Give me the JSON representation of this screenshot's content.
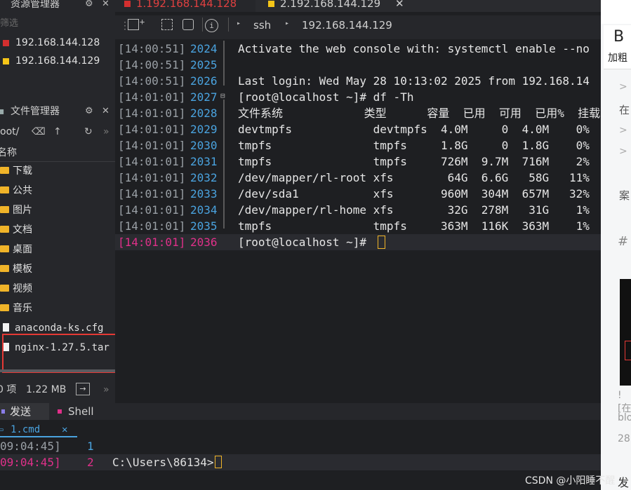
{
  "resource_manager": {
    "title": "资源管理器",
    "filter_placeholder": "筛选",
    "sessions": [
      {
        "label": "192.168.144.128",
        "color": "#d32f2f"
      },
      {
        "label": "192.168.144.129",
        "color": "#f5c518"
      }
    ]
  },
  "file_manager": {
    "title": "文件管理器",
    "path": "oot/",
    "column_name": "名称",
    "items": [
      {
        "name": "下载",
        "type": "folder"
      },
      {
        "name": "公共",
        "type": "folder"
      },
      {
        "name": "图片",
        "type": "folder"
      },
      {
        "name": "文档",
        "type": "folder"
      },
      {
        "name": "桌面",
        "type": "folder"
      },
      {
        "name": "模板",
        "type": "folder"
      },
      {
        "name": "视频",
        "type": "folder"
      },
      {
        "name": "音乐",
        "type": "folder"
      },
      {
        "name": "anaconda-ks.cfg",
        "type": "file"
      },
      {
        "name": "nginx-1.27.5.tar",
        "type": "file"
      }
    ],
    "status_count": "0 项",
    "status_size": "1.22 MB"
  },
  "tabs": [
    {
      "label": "1.192.168.144.128",
      "color": "#d32f2f"
    },
    {
      "label": "2.192.168.144.129",
      "color": "#f5c518"
    }
  ],
  "toolbar": {
    "proto": "ssh",
    "host": "192.168.144.129"
  },
  "terminal": {
    "lines": [
      {
        "ts": "[14:00:51]",
        "n": "2024",
        "text": "Activate the web console with: systemctl enable --no"
      },
      {
        "ts": "[14:00:51]",
        "n": "2025",
        "text": ""
      },
      {
        "ts": "[14:00:51]",
        "n": "2026",
        "text": "Last login: Wed May 28 10:13:02 2025 from 192.168.14"
      },
      {
        "ts": "[14:01:01]",
        "n": "2027",
        "text": "[root@localhost ~]# df -Th"
      },
      {
        "ts": "[14:01:01]",
        "n": "2028",
        "text": "文件系统            类型      容量  已用  可用  已用%  挂载"
      },
      {
        "ts": "[14:01:01]",
        "n": "2029",
        "text": "devtmpfs            devtmpfs  4.0M     0  4.0M    0%"
      },
      {
        "ts": "[14:01:01]",
        "n": "2030",
        "text": "tmpfs               tmpfs     1.8G     0  1.8G    0%"
      },
      {
        "ts": "[14:01:01]",
        "n": "2031",
        "text": "tmpfs               tmpfs     726M  9.7M  716M    2%"
      },
      {
        "ts": "[14:01:01]",
        "n": "2032",
        "text": "/dev/mapper/rl-root xfs        64G  6.6G   58G   11%"
      },
      {
        "ts": "[14:01:01]",
        "n": "2033",
        "text": "/dev/sda1           xfs       960M  304M  657M   32%"
      },
      {
        "ts": "[14:01:01]",
        "n": "2034",
        "text": "/dev/mapper/rl-home xfs        32G  278M   31G    1%"
      },
      {
        "ts": "[14:01:01]",
        "n": "2035",
        "text": "tmpfs               tmpfs     363M  116K  363M    1%"
      },
      {
        "ts": "[14:01:01]",
        "n": "2036",
        "text": "[root@localhost ~]# "
      }
    ]
  },
  "bottom": {
    "tabs": [
      {
        "label": "发送"
      },
      {
        "label": "Shell"
      }
    ],
    "cmd_tab": "1.cmd",
    "lines": [
      {
        "ts": "09:04:45]",
        "n": "1",
        "text": ""
      },
      {
        "ts": "09:04:45]",
        "n": "2",
        "text": "C:\\Users\\86134>"
      }
    ]
  },
  "right_panel": {
    "bold_label": "加粗",
    "b_glyph": "B",
    "snippets": [
      "在",
      "案",
      "#",
      "![在",
      "blo",
      "28"
    ],
    "footer": "发"
  },
  "watermark": "CSDN @小阳睡不醒"
}
